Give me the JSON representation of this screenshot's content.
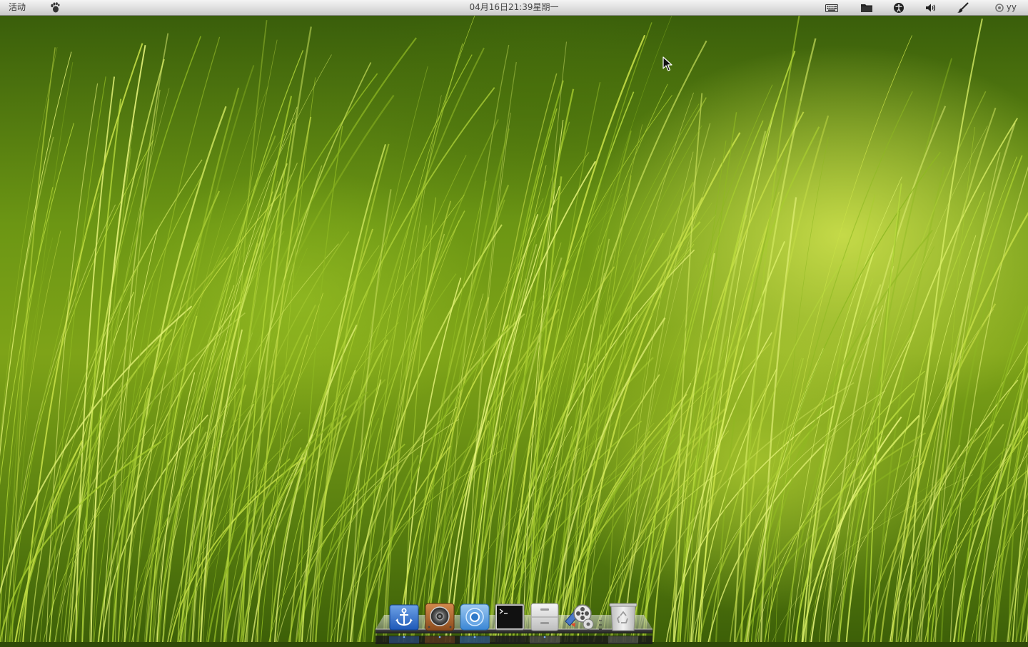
{
  "top_panel": {
    "activities_label": "活动",
    "clock_text": "04月16日21:39星期一",
    "user_name": "yy",
    "icons": {
      "app_menu": "gnome-foot-icon",
      "keyboard": "keyboard-icon",
      "files": "folder-icon",
      "accessibility": "accessibility-icon",
      "volume": "volume-icon",
      "tools": "paintbrush-icon",
      "status": "user-status-icon"
    }
  },
  "dock": {
    "items": [
      {
        "name": "docky-anchor",
        "icon": "anchor-icon"
      },
      {
        "name": "rhythmbox",
        "icon": "speaker-icon"
      },
      {
        "name": "chromium",
        "icon": "chromium-icon"
      },
      {
        "name": "terminal",
        "icon": "terminal-icon"
      },
      {
        "name": "file-cabinet",
        "icon": "file-cabinet-icon"
      },
      {
        "name": "video-player",
        "icon": "film-reel-icon"
      },
      {
        "name": "trash",
        "icon": "trash-icon"
      }
    ]
  },
  "colors": {
    "panel_top": "#f4f4f4",
    "panel_bottom": "#c9c9c9",
    "grass_light": "#d8ec5a",
    "grass_dark": "#2f4a08"
  }
}
